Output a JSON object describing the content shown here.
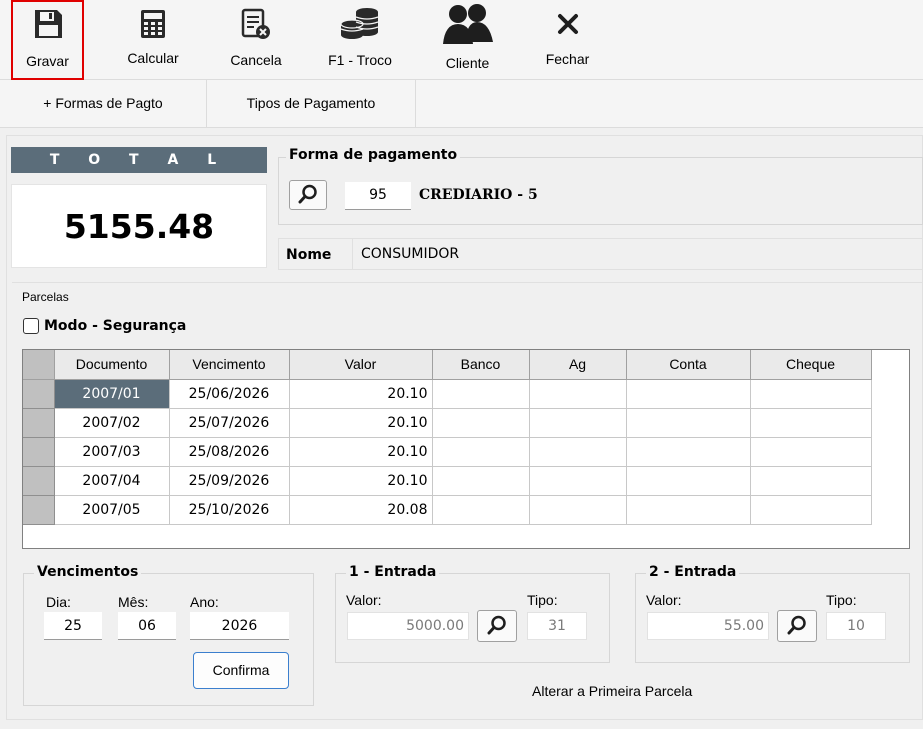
{
  "toolbar": {
    "gravar": "Gravar",
    "calcular": "Calcular",
    "cancela": "Cancela",
    "troco": "F1 - Troco",
    "cliente": "Cliente",
    "fechar": "Fechar"
  },
  "tabs": {
    "formas": "+ Formas de Pagto",
    "tipos": "Tipos de Pagamento"
  },
  "total": {
    "label": "T O T A L",
    "value": "5155.48"
  },
  "forma_pagamento": {
    "title": "Forma de pagamento",
    "code": "95",
    "name": "CREDIARIO - 5"
  },
  "nome": {
    "label": "Nome",
    "value": "CONSUMIDOR"
  },
  "parcelas": {
    "label": "Parcelas",
    "modo_seguranca": "Modo - Segurança",
    "columns": [
      "Documento",
      "Vencimento",
      "Valor",
      "Banco",
      "Ag",
      "Conta",
      "Cheque"
    ],
    "rows": [
      [
        "2007/01",
        "25/06/2026",
        "20.10",
        "",
        "",
        "",
        ""
      ],
      [
        "2007/02",
        "25/07/2026",
        "20.10",
        "",
        "",
        "",
        ""
      ],
      [
        "2007/03",
        "25/08/2026",
        "20.10",
        "",
        "",
        "",
        ""
      ],
      [
        "2007/04",
        "25/09/2026",
        "20.10",
        "",
        "",
        "",
        ""
      ],
      [
        "2007/05",
        "25/10/2026",
        "20.08",
        "",
        "",
        "",
        ""
      ]
    ]
  },
  "vencimentos": {
    "title": "Vencimentos",
    "dia_label": "Dia:",
    "mes_label": "Mês:",
    "ano_label": "Ano:",
    "dia": "25",
    "mes": "06",
    "ano": "2026",
    "confirma": "Confirma"
  },
  "entrada1": {
    "title": "1 - Entrada",
    "valor_label": "Valor:",
    "tipo_label": "Tipo:",
    "valor": "5000.00",
    "tipo": "31"
  },
  "entrada2": {
    "title": "2 - Entrada",
    "valor_label": "Valor:",
    "tipo_label": "Tipo:",
    "valor": "55.00",
    "tipo": "10"
  },
  "alterar": "Alterar a Primeira Parcela"
}
